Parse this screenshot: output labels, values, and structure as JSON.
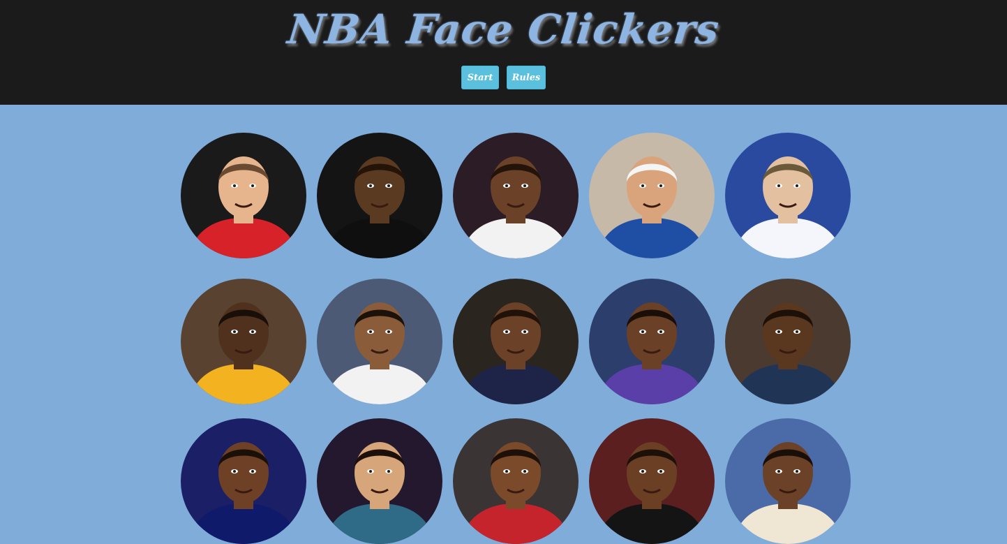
{
  "header": {
    "title": "NBA Face Clickers",
    "start_label": "Start",
    "rules_label": "Rules"
  },
  "colors": {
    "page_background": "#80acda",
    "header_background": "#1b1b1b",
    "title_color": "#8eb4e2",
    "button_color": "#5bc0de"
  },
  "faces": [
    {
      "name": "face-1",
      "skin": "#e7b58d",
      "hair": "#6a4a30",
      "jersey": "#d8222a",
      "bg": "#1a1a1a"
    },
    {
      "name": "face-2",
      "skin": "#5b3a22",
      "hair": "#241307",
      "jersey": "#0f0f0f",
      "bg": "#141414"
    },
    {
      "name": "face-3",
      "skin": "#6b4128",
      "hair": "#231309",
      "jersey": "#f2f2f2",
      "bg": "#2b1c26"
    },
    {
      "name": "face-4",
      "skin": "#d9a47c",
      "hair": "#f5f5f5",
      "jersey": "#1f4fa5",
      "bg": "#c6b9a8"
    },
    {
      "name": "face-5",
      "skin": "#e3c0a0",
      "hair": "#6b5a3a",
      "jersey": "#f4f6fb",
      "bg": "#2a4aa0"
    },
    {
      "name": "face-6",
      "skin": "#4f311d",
      "hair": "#1a0f08",
      "jersey": "#f3b320",
      "bg": "#5a4230"
    },
    {
      "name": "face-7",
      "skin": "#8a5c3a",
      "hair": "#1d120a",
      "jersey": "#f2f2f2",
      "bg": "#4c5a76"
    },
    {
      "name": "face-8",
      "skin": "#6b4127",
      "hair": "#201208",
      "jersey": "#1d2447",
      "bg": "#2b2520"
    },
    {
      "name": "face-9",
      "skin": "#6a4126",
      "hair": "#1a0f08",
      "jersey": "#5a3fa8",
      "bg": "#2c3e6b"
    },
    {
      "name": "face-10",
      "skin": "#5a371f",
      "hair": "#1c1008",
      "jersey": "#203456",
      "bg": "#4a3a30"
    },
    {
      "name": "face-11",
      "skin": "#6e4126",
      "hair": "#1a1008",
      "jersey": "#101a6b",
      "bg": "#1b1f66"
    },
    {
      "name": "face-12",
      "skin": "#d6a67a",
      "hair": "#1c1008",
      "jersey": "#2f6a86",
      "bg": "#24182e"
    },
    {
      "name": "face-13",
      "skin": "#7a4a2a",
      "hair": "#1c1008",
      "jersey": "#c6242d",
      "bg": "#3b3434"
    },
    {
      "name": "face-14",
      "skin": "#6a3f24",
      "hair": "#1c1008",
      "jersey": "#141414",
      "bg": "#5b1f20"
    },
    {
      "name": "face-15",
      "skin": "#6b4127",
      "hair": "#1a0f08",
      "jersey": "#efe7d3",
      "bg": "#4a6aa8"
    }
  ]
}
